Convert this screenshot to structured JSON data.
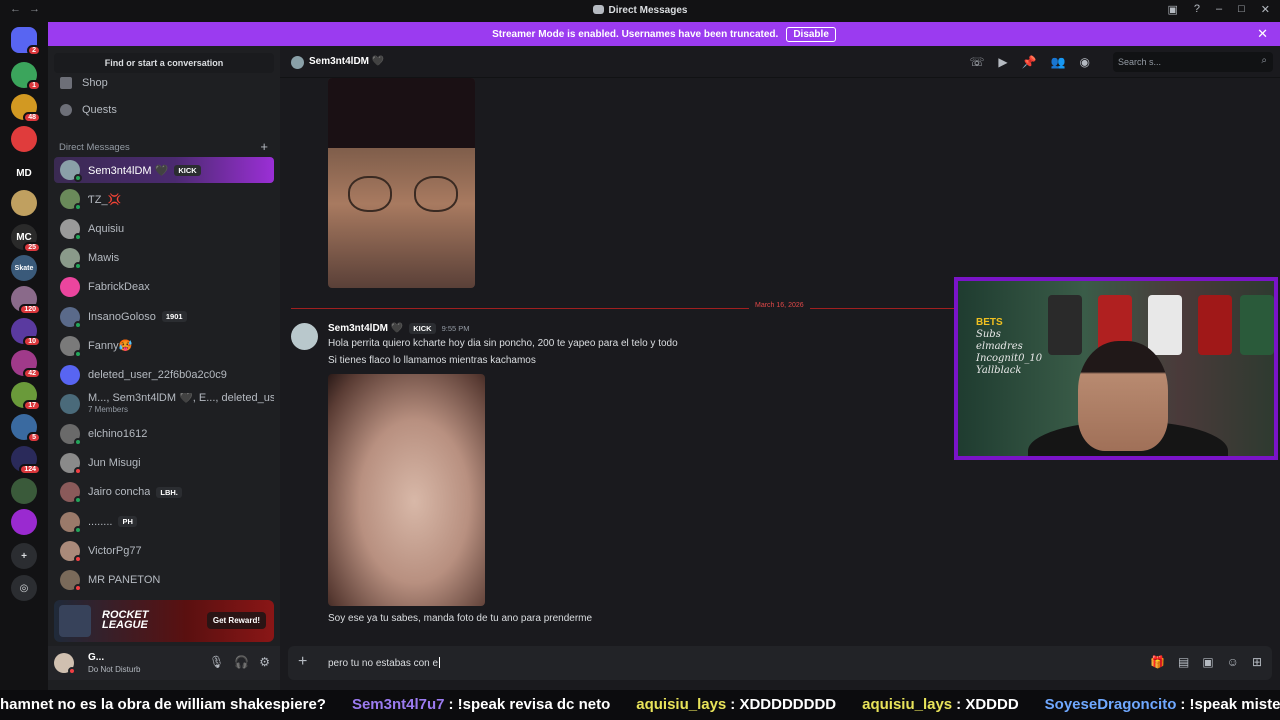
{
  "window": {
    "title": "Direct Messages"
  },
  "banner": {
    "text": "Streamer Mode is enabled. Usernames have been truncated.",
    "disable_label": "Disable"
  },
  "guilds": [
    {
      "label": "",
      "badge": "2",
      "color": "#5865f2"
    },
    {
      "label": "",
      "badge": "1",
      "color": "#3ba55c"
    },
    {
      "label": "",
      "badge": "48",
      "color": "#d29922"
    },
    {
      "label": "",
      "badge": "",
      "color": "#e03c3c"
    },
    {
      "label": "MD",
      "badge": "",
      "color": "#121214"
    },
    {
      "label": "",
      "badge": "",
      "color": "#c0a060"
    },
    {
      "label": "MC",
      "badge": "25",
      "color": "#2a2a2a"
    },
    {
      "label": "Skate",
      "badge": "",
      "color": "#3a5a7a"
    },
    {
      "label": "",
      "badge": "120",
      "color": "#8a6a8a"
    },
    {
      "label": "",
      "badge": "10",
      "color": "#5a3aa0"
    },
    {
      "label": "",
      "badge": "42",
      "color": "#a03a8a"
    },
    {
      "label": "",
      "badge": "17",
      "color": "#6a9a3a"
    },
    {
      "label": "",
      "badge": "5",
      "color": "#3a6aa0"
    },
    {
      "label": "",
      "badge": "124",
      "color": "#2a2a5a"
    },
    {
      "label": "",
      "badge": "",
      "color": "#3a5a3a"
    },
    {
      "label": "",
      "badge": "",
      "color": "#9a2ad0"
    }
  ],
  "sidebar": {
    "find_label": "Find or start a conversation",
    "nav": [
      {
        "label": "Shop"
      },
      {
        "label": "Quests"
      }
    ],
    "dm_header": "Direct Messages",
    "dms": [
      {
        "name": "Sem3nt4lDM 🖤",
        "tag": "KICK",
        "sub": "",
        "color": "#8aa0a8",
        "status": "#23a55a"
      },
      {
        "name": "ƬZ_💢",
        "tag": "",
        "sub": "",
        "color": "#6a8a5a",
        "status": "#23a55a"
      },
      {
        "name": "Aquisiu",
        "tag": "",
        "sub": "",
        "color": "#9a9a9a",
        "status": "#23a55a"
      },
      {
        "name": "Mawis",
        "tag": "",
        "sub": "",
        "color": "#8a9a8a",
        "status": "#23a55a"
      },
      {
        "name": "FabrickDeax",
        "tag": "",
        "sub": "",
        "color": "#eb459e",
        "status": ""
      },
      {
        "name": "InsanoGoloso",
        "tag": "1901",
        "sub": "",
        "color": "#5a6a8a",
        "status": "#23a55a"
      },
      {
        "name": "Fanny🥵",
        "tag": "",
        "sub": "",
        "color": "#7a7a7a",
        "status": "#23a55a"
      },
      {
        "name": "deleted_user_22f6b0a2c0c9",
        "tag": "",
        "sub": "",
        "color": "#5865f2",
        "status": ""
      },
      {
        "name": "M..., Sem3nt4lDM 🖤, E..., deleted_us...",
        "tag": "",
        "sub": "7 Members",
        "color": "#4a6a7a",
        "status": ""
      },
      {
        "name": "elchino1612",
        "tag": "",
        "sub": "",
        "color": "#6a6a6a",
        "status": "#23a55a"
      },
      {
        "name": "Jun Misugi",
        "tag": "",
        "sub": "",
        "color": "#8a8a8a",
        "status": "#f23f43"
      },
      {
        "name": "Jairo concha",
        "tag": "LBH.",
        "sub": "",
        "color": "#8a5a5a",
        "status": "#23a55a"
      },
      {
        "name": "........",
        "tag": "PH",
        "sub": "",
        "color": "#9a7a6a",
        "status": "#23a55a"
      },
      {
        "name": "VictorPg77",
        "tag": "",
        "sub": "",
        "color": "#aa8a7a",
        "status": "#f23f43"
      },
      {
        "name": "MR PANETON",
        "tag": "",
        "sub": "",
        "color": "#7a6a5a",
        "status": "#f23f43"
      }
    ],
    "promo": {
      "logo_line1": "ROCKET",
      "logo_line2": "LEAGUE",
      "button": "Get Reward!"
    },
    "user": {
      "name": "G...",
      "status": "Do Not Disturb"
    }
  },
  "chat": {
    "channel_name": "Sem3nt4lDM 🖤",
    "search_placeholder": "Search s...",
    "divider_date": "March 16, 2026",
    "message": {
      "author": "Sem3nt4lDM 🖤",
      "tag": "KICK",
      "time": "9:55 PM",
      "lines": [
        "Hola perrita quiero kcharte hoy dia sin poncho, 200 te yapeo para el telo y todo",
        "Si tienes flaco lo llamamos mientras kachamos"
      ],
      "after_image": "Soy ese ya tu sabes, manda foto de tu ano para prenderme"
    },
    "composer_text": "pero tu no estabas con e"
  },
  "overlay": {
    "cam_brand": "BETS",
    "cam_lines": [
      "Subs",
      "elmadres",
      "Incognit0_10",
      "Yallblack"
    ]
  },
  "ticker": [
    {
      "user": "",
      "text": "hamnet no es la obra de william shakespiere?"
    },
    {
      "user": "Sem3nt4l7u7",
      "text": ": !speak revisa dc neto"
    },
    {
      "user": "aquisiu_lays",
      "text": ": XDDDDDDDD"
    },
    {
      "user": "aquisiu_lays",
      "text": ": XDDDD"
    },
    {
      "user": "SoyeseDragoncito",
      "text": ": !speak misterioso tones"
    }
  ]
}
